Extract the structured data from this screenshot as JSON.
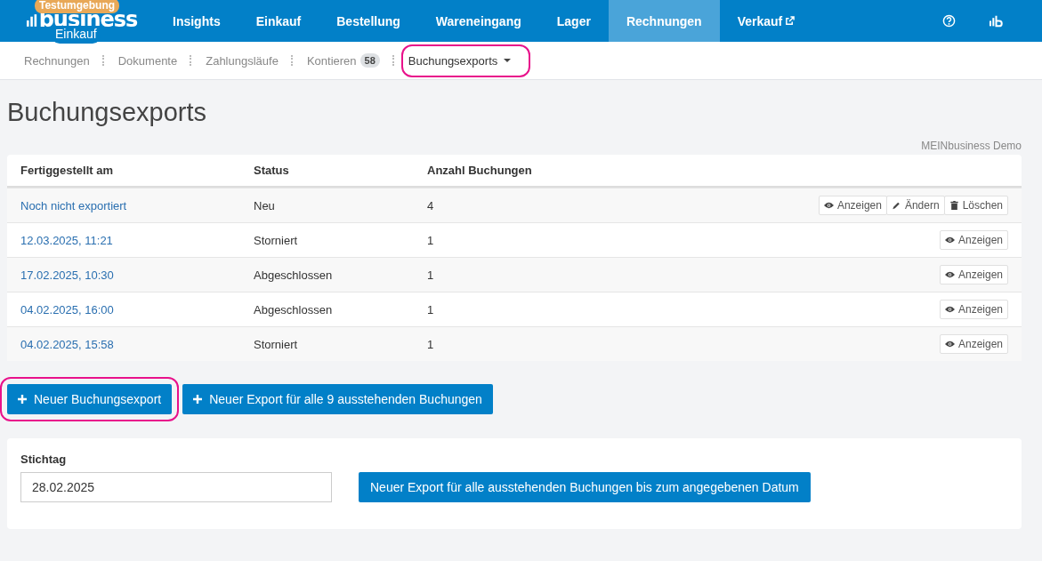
{
  "logo": {
    "badge": "Testumgebung",
    "wordmark": "business",
    "subtitle": "Einkauf"
  },
  "nav": [
    {
      "label": "Insights",
      "selected": false,
      "external": false
    },
    {
      "label": "Einkauf",
      "selected": false,
      "external": false
    },
    {
      "label": "Bestellung",
      "selected": false,
      "external": false
    },
    {
      "label": "Wareneingang",
      "selected": false,
      "external": false
    },
    {
      "label": "Lager",
      "selected": false,
      "external": false
    },
    {
      "label": "Rechnungen",
      "selected": true,
      "external": false
    },
    {
      "label": "Verkauf",
      "selected": false,
      "external": true
    }
  ],
  "subnav": [
    {
      "label": "Rechnungen",
      "selected": false,
      "dropdown": false,
      "highlighted": false
    },
    {
      "label": "Dokumente",
      "selected": false,
      "dropdown": false,
      "highlighted": false
    },
    {
      "label": "Zahlungsläufe",
      "selected": false,
      "dropdown": false,
      "highlighted": false
    },
    {
      "label": "Kontieren",
      "badge": "58",
      "selected": false,
      "dropdown": false,
      "highlighted": false
    },
    {
      "label": "Buchungsexports",
      "selected": true,
      "dropdown": true,
      "highlighted": true
    }
  ],
  "page_title": "Buchungsexports",
  "company": "MEINbusiness Demo",
  "table": {
    "columns": [
      "Fertiggestellt am",
      "Status",
      "Anzahl Buchungen"
    ],
    "rows": [
      {
        "date": "Noch nicht exportiert",
        "status": "Neu",
        "count": "4",
        "actions": [
          {
            "kind": "view",
            "label": "Anzeigen"
          },
          {
            "kind": "edit",
            "label": "Ändern"
          },
          {
            "kind": "delete",
            "label": "Löschen"
          }
        ]
      },
      {
        "date": "12.03.2025, 11:21",
        "status": "Storniert",
        "count": "1",
        "actions": [
          {
            "kind": "view",
            "label": "Anzeigen"
          }
        ]
      },
      {
        "date": "17.02.2025, 10:30",
        "status": "Abgeschlossen",
        "count": "1",
        "actions": [
          {
            "kind": "view",
            "label": "Anzeigen"
          }
        ]
      },
      {
        "date": "04.02.2025, 16:00",
        "status": "Abgeschlossen",
        "count": "1",
        "actions": [
          {
            "kind": "view",
            "label": "Anzeigen"
          }
        ]
      },
      {
        "date": "04.02.2025, 15:58",
        "status": "Storniert",
        "count": "1",
        "actions": [
          {
            "kind": "view",
            "label": "Anzeigen"
          }
        ]
      }
    ]
  },
  "buttons": [
    {
      "label": "Neuer Buchungsexport",
      "highlighted": true
    },
    {
      "label": "Neuer Export für alle 9 ausstehenden Buchungen",
      "highlighted": false
    }
  ],
  "cutoff": {
    "label": "Stichtag",
    "value": "28.02.2025",
    "button": "Neuer Export für alle ausstehenden Buchungen bis zum angegebenen Datum"
  }
}
